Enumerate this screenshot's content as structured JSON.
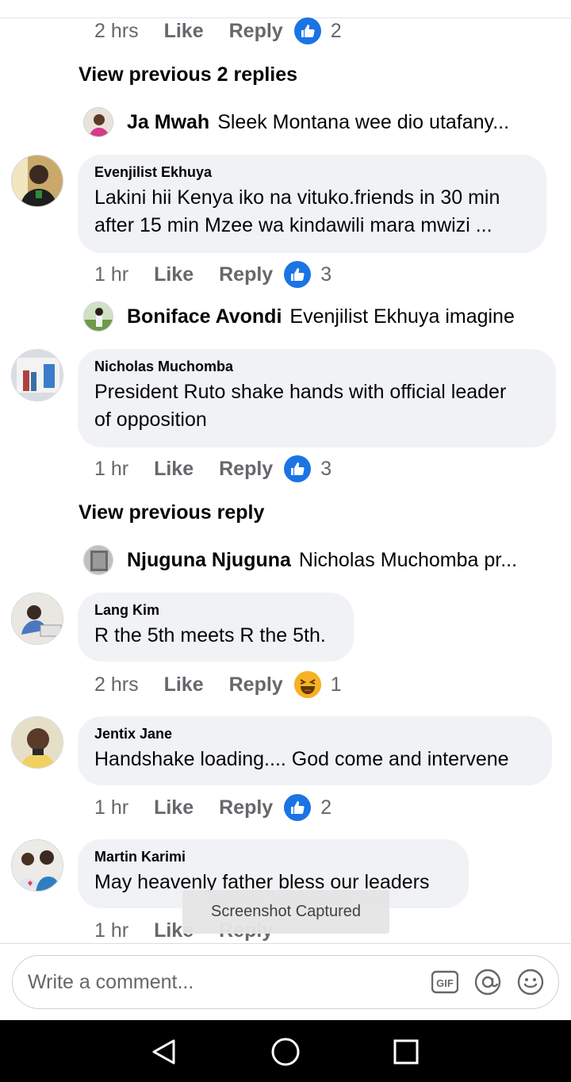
{
  "top_meta": {
    "time": "2 hrs",
    "like": "Like",
    "reply": "Reply",
    "count": "2"
  },
  "thread1": {
    "view_prev": "View previous 2 replies",
    "reply": {
      "name": "Ja Mwah",
      "text": "Sleek Montana wee dio utafany..."
    }
  },
  "comments": [
    {
      "author": "Evenjilist Ekhuya",
      "lines": [
        "Lakini hii Kenya iko na vituko.friends in 30 min",
        "after 15 min Mzee wa kindawili mara mwizi ..."
      ],
      "time": "1 hr",
      "reaction": "like",
      "count": "3"
    },
    {
      "author": "Nicholas Muchomba",
      "lines": [
        "President Ruto shake hands with official leader",
        "of opposition"
      ],
      "time": "1 hr",
      "reaction": "like",
      "count": "3"
    },
    {
      "author": "Lang Kim",
      "lines": [
        "R the 5th meets R the 5th."
      ],
      "time": "2 hrs",
      "reaction": "haha",
      "count": "1"
    },
    {
      "author": "Jentix Jane",
      "lines": [
        "Handshake loading.... God come and intervene"
      ],
      "time": "1 hr",
      "reaction": "like",
      "count": "2"
    },
    {
      "author": "Martin Karimi",
      "lines": [
        "May heavenly father bless our leaders"
      ],
      "time": "1 hr",
      "reaction": "",
      "count": ""
    }
  ],
  "actions": {
    "like": "Like",
    "reply": "Reply"
  },
  "reply_boniface": {
    "name": "Boniface Avondi",
    "text": "Evenjilist Ekhuya imagine"
  },
  "thread2": {
    "view_prev": "View previous reply",
    "reply": {
      "name": "Njuguna Njuguna",
      "text": "Nicholas Muchomba pr..."
    }
  },
  "toast": "Screenshot Captured",
  "composer": {
    "placeholder": "Write a comment...",
    "gif": "GIF"
  },
  "colors": {
    "accent": "#1b74e4",
    "bubble": "#f0f2f5",
    "meta": "#65676b"
  }
}
